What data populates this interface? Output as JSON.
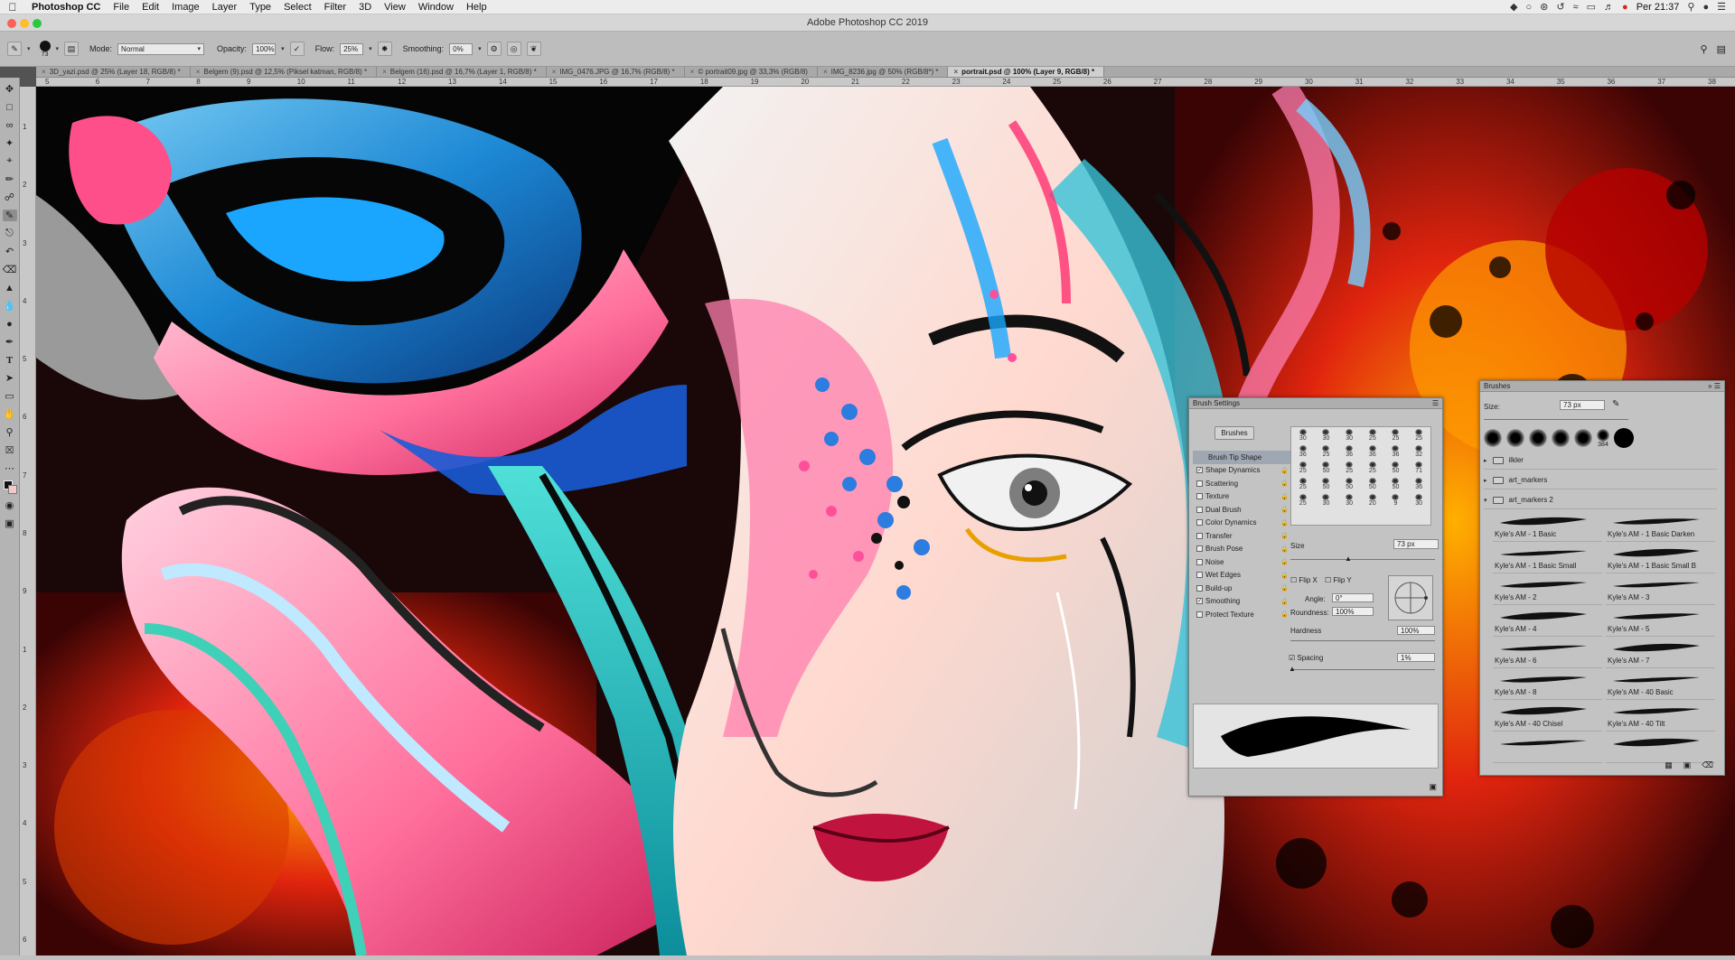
{
  "menubar": {
    "app": "Photoshop CC",
    "items": [
      "File",
      "Edit",
      "Image",
      "Layer",
      "Type",
      "Select",
      "Filter",
      "3D",
      "View",
      "Window",
      "Help"
    ],
    "clock": "Per 21:37"
  },
  "window": {
    "title": "Adobe Photoshop CC 2019"
  },
  "options": {
    "brush_size": "73",
    "mode_label": "Mode:",
    "mode_value": "Normal",
    "opacity_label": "Opacity:",
    "opacity_value": "100%",
    "flow_label": "Flow:",
    "flow_value": "25%",
    "smoothing_label": "Smoothing:",
    "smoothing_value": "0%"
  },
  "tabs": [
    "3D_yazi.psd @ 25% (Layer 18, RGB/8) *",
    "Belgem (9).psd @ 12,5% (Piksel katman, RGB/8) *",
    "Belgem (16).psd @ 16,7% (Layer 1, RGB/8) *",
    "IMG_0476.JPG @ 16,7% (RGB/8) *",
    "© portrait09.jpg @ 33,3% (RGB/8)",
    "IMG_8236.jpg @ 50% (RGB/8*) *",
    "portrait.psd @ 100% (Layer 9, RGB/8) *"
  ],
  "ruler_top": [
    "5",
    "6",
    "7",
    "8",
    "9",
    "10",
    "11",
    "12",
    "13",
    "14",
    "15",
    "16",
    "17",
    "18",
    "19",
    "20",
    "21",
    "22",
    "23",
    "24",
    "25",
    "26",
    "27",
    "28",
    "29",
    "30",
    "31",
    "32",
    "33",
    "34",
    "35",
    "36",
    "37",
    "38"
  ],
  "ruler_left": [
    "1",
    "2",
    "3",
    "4",
    "5",
    "6",
    "7",
    "8",
    "9",
    "1",
    "2",
    "3",
    "4",
    "5",
    "6"
  ],
  "brush_settings": {
    "title": "Brush Settings",
    "brushes_button": "Brushes",
    "options": [
      {
        "label": "Brush Tip Shape",
        "checkbox": false,
        "selected": true
      },
      {
        "label": "Shape Dynamics",
        "checkbox": true,
        "checked": true
      },
      {
        "label": "Scattering",
        "checkbox": true,
        "checked": false
      },
      {
        "label": "Texture",
        "checkbox": true,
        "checked": false
      },
      {
        "label": "Dual Brush",
        "checkbox": true,
        "checked": false
      },
      {
        "label": "Color Dynamics",
        "checkbox": true,
        "checked": false
      },
      {
        "label": "Transfer",
        "checkbox": true,
        "checked": false
      },
      {
        "label": "Brush Pose",
        "checkbox": true,
        "checked": false
      },
      {
        "label": "Noise",
        "checkbox": true,
        "checked": false
      },
      {
        "label": "Wet Edges",
        "checkbox": true,
        "checked": false
      },
      {
        "label": "Build-up",
        "checkbox": true,
        "checked": false
      },
      {
        "label": "Smoothing",
        "checkbox": true,
        "checked": true
      },
      {
        "label": "Protect Texture",
        "checkbox": true,
        "checked": false
      }
    ],
    "tip_sizes": [
      "30",
      "30",
      "30",
      "25",
      "25",
      "25",
      "36",
      "25",
      "36",
      "36",
      "36",
      "32",
      "25",
      "50",
      "25",
      "25",
      "50",
      "71",
      "25",
      "50",
      "50",
      "50",
      "50",
      "36",
      "25",
      "30",
      "30",
      "20",
      "9",
      "30"
    ],
    "size_label": "Size",
    "size_value": "73 px",
    "flipx": "Flip X",
    "flipy": "Flip Y",
    "angle_label": "Angle:",
    "angle_value": "0°",
    "roundness_label": "Roundness:",
    "roundness_value": "100%",
    "hardness_label": "Hardness",
    "hardness_value": "100%",
    "spacing_label": "Spacing",
    "spacing_value": "1%"
  },
  "brushes_panel": {
    "title": "Brushes",
    "size_label": "Size:",
    "size_value": "73 px",
    "tip_label": "384",
    "folders": [
      "ilkler",
      "art_markers",
      "art_markers 2"
    ],
    "items": [
      "Kyle's AM - 1 Basic",
      "Kyle's AM - 1 Basic Darken",
      "Kyle's AM - 1 Basic Small",
      "Kyle's AM - 1 Basic Small B",
      "Kyle's AM - 2",
      "Kyle's AM - 3",
      "Kyle's AM - 4",
      "Kyle's AM - 5",
      "Kyle's AM - 6",
      "Kyle's AM - 7",
      "Kyle's AM - 8",
      "Kyle's AM - 40 Basic",
      "Kyle's AM - 40 Chisel",
      "Kyle's AM - 40 Tilt",
      "",
      ""
    ]
  },
  "colors": {
    "accent_selected": "#9fa7b3",
    "panel_bg": "#c3c3c3"
  }
}
